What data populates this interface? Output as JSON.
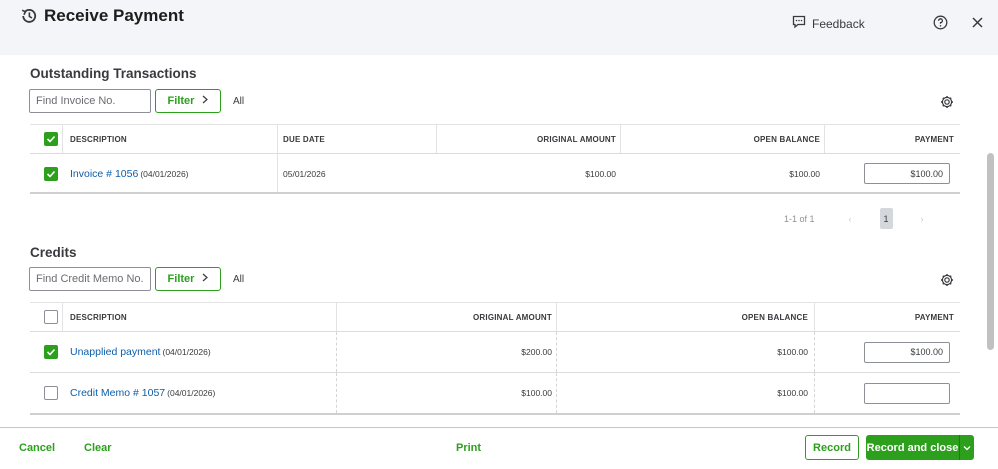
{
  "header": {
    "title": "Receive Payment",
    "feedback_label": "Feedback"
  },
  "outstanding": {
    "title": "Outstanding Transactions",
    "search_placeholder": "Find Invoice No.",
    "filter_label": "Filter",
    "all_label": "All",
    "columns": [
      "DESCRIPTION",
      "DUE DATE",
      "ORIGINAL AMOUNT",
      "OPEN BALANCE",
      "PAYMENT"
    ],
    "header_checked": true,
    "rows": [
      {
        "checked": true,
        "description": "Invoice # 1056",
        "date": "(04/01/2026)",
        "due_date": "05/01/2026",
        "original_amount": "$100.00",
        "open_balance": "$100.00",
        "payment": "$100.00"
      }
    ],
    "pager": {
      "range": "1-1 of 1",
      "prev": "‹",
      "page": "1",
      "next": "›"
    }
  },
  "credits": {
    "title": "Credits",
    "search_placeholder": "Find Credit Memo No.",
    "filter_label": "Filter",
    "all_label": "All",
    "columns": [
      "DESCRIPTION",
      "ORIGINAL AMOUNT",
      "OPEN BALANCE",
      "PAYMENT"
    ],
    "header_checked": false,
    "rows": [
      {
        "checked": true,
        "description": "Unapplied payment",
        "date": "(04/01/2026)",
        "original_amount": "$200.00",
        "open_balance": "$100.00",
        "payment": "$100.00"
      },
      {
        "checked": false,
        "description": "Credit Memo # 1057",
        "date": "(04/01/2026)",
        "original_amount": "$100.00",
        "open_balance": "$100.00",
        "payment": ""
      }
    ]
  },
  "footer": {
    "cancel_label": "Cancel",
    "clear_label": "Clear",
    "print_label": "Print",
    "record_label": "Record",
    "record_close_label": "Record and close"
  },
  "colors": {
    "accent_green": "#2ca01c",
    "link_blue": "#0d5ea9",
    "header_bg": "#f4f5f8"
  },
  "icons": [
    "history-icon",
    "feedback-icon",
    "help-icon",
    "close-icon",
    "gear-icon",
    "check-icon",
    "chevron-right-icon",
    "chevron-down-icon"
  ]
}
